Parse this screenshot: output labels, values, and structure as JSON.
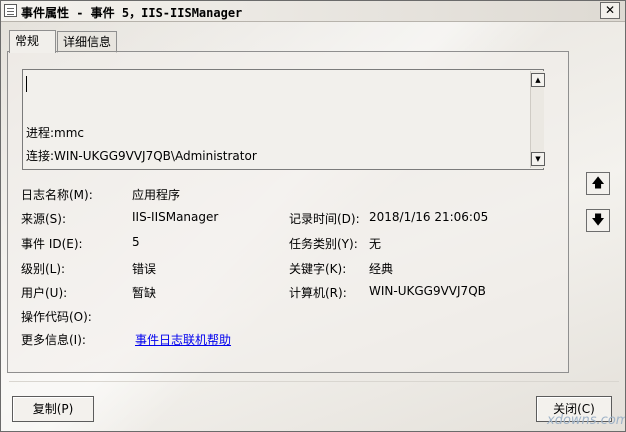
{
  "window": {
    "title": "事件属性 - 事件 5，IIS-IISManager",
    "close_glyph": "✕"
  },
  "tabs": [
    {
      "label": "常规"
    },
    {
      "label": "详细信息"
    }
  ],
  "description": {
    "lines": [
      "进程:mmc",
      "连接:WIN-UKGG9VVJ7QB\\Administrator"
    ],
    "scroll_up_glyph": "▲",
    "scroll_down_glyph": "▼"
  },
  "fields": {
    "log_name": {
      "label": "日志名称(M):",
      "value": "应用程序"
    },
    "source": {
      "label": "来源(S):",
      "value": "IIS-IISManager"
    },
    "logged": {
      "label": "记录时间(D):",
      "value": "2018/1/16 21:06:05"
    },
    "event_id": {
      "label": "事件 ID(E):",
      "value": "5"
    },
    "task_category": {
      "label": "任务类别(Y):",
      "value": "无"
    },
    "level": {
      "label": "级别(L):",
      "value": "错误"
    },
    "keywords": {
      "label": "关键字(K):",
      "value": "经典"
    },
    "user": {
      "label": "用户(U):",
      "value": "暂缺"
    },
    "computer": {
      "label": "计算机(R):",
      "value": "WIN-UKGG9VVJ7QB"
    },
    "opcode": {
      "label": "操作代码(O):",
      "value": ""
    },
    "more_info": {
      "label": "更多信息(I):",
      "link": "事件日志联机帮助"
    }
  },
  "nav": {
    "up_glyph": "🡅",
    "down_glyph": "🡇"
  },
  "buttons": {
    "copy": "复制(P)",
    "close": "关闭(C)"
  },
  "watermark": "xdowns.com"
}
